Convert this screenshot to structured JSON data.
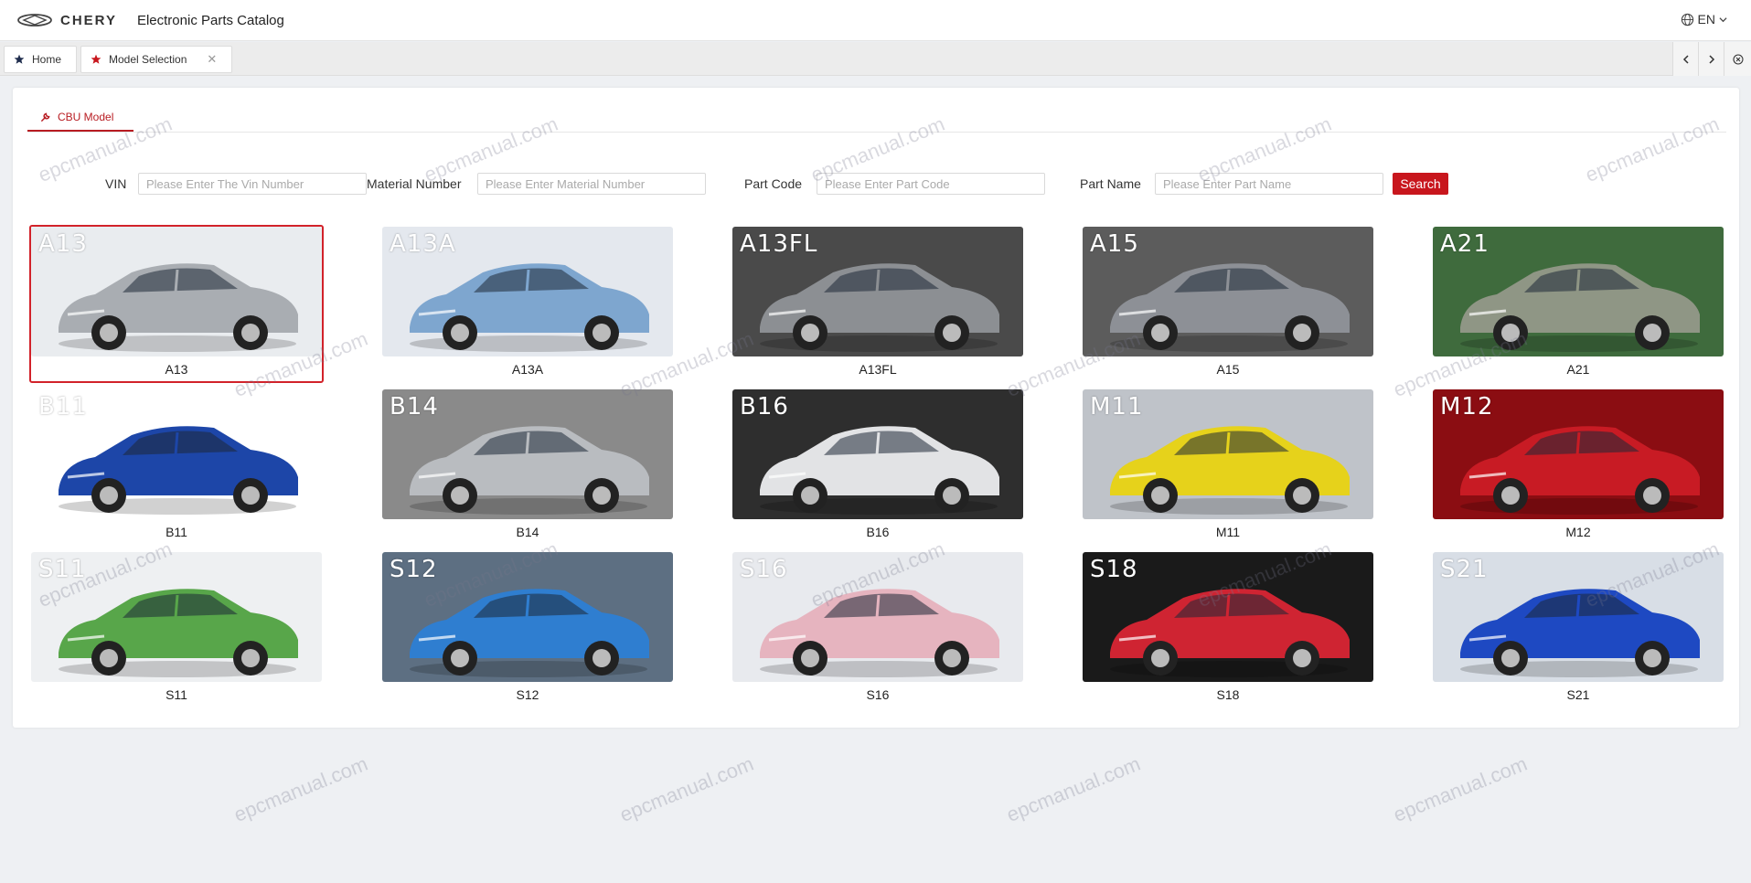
{
  "header": {
    "brand": "CHERY",
    "title": "Electronic Parts Catalog",
    "language": "EN"
  },
  "tabs": [
    {
      "label": "Home",
      "closable": false
    },
    {
      "label": "Model Selection",
      "closable": true
    }
  ],
  "section": {
    "label": "CBU Model"
  },
  "search": {
    "vin_label": "VIN",
    "vin_placeholder": "Please Enter The Vin Number",
    "material_label": "Material Number",
    "material_placeholder": "Please Enter Material Number",
    "partcode_label": "Part Code",
    "partcode_placeholder": "Please Enter Part Code",
    "partname_label": "Part Name",
    "partname_placeholder": "Please Enter Part Name",
    "button_label": "Search"
  },
  "models": [
    {
      "code": "A13",
      "label": "A13",
      "car_color": "#a9adb2",
      "bg": "#e9ecef",
      "selected": true
    },
    {
      "code": "A13A",
      "label": "A13A",
      "car_color": "#7ea6cf",
      "bg": "#e4e8ee"
    },
    {
      "code": "A13FL",
      "label": "A13FL",
      "car_color": "#8c8f93",
      "bg": "#4a4a4a"
    },
    {
      "code": "A15",
      "label": "A15",
      "car_color": "#8d9096",
      "bg": "#5c5c5c"
    },
    {
      "code": "A21",
      "label": "A21",
      "car_color": "#8f9685",
      "bg": "#3f6b3d"
    },
    {
      "code": "B11",
      "label": "B11",
      "car_color": "#1d46a8",
      "bg": "#ffffff"
    },
    {
      "code": "B14",
      "label": "B14",
      "car_color": "#b9bcc0",
      "bg": "#8a8a8a"
    },
    {
      "code": "B16",
      "label": "B16",
      "car_color": "#e2e3e5",
      "bg": "#2e2e2e"
    },
    {
      "code": "M11",
      "label": "M11",
      "car_color": "#e6d21b",
      "bg": "#bfc3c9"
    },
    {
      "code": "M12",
      "label": "M12",
      "car_color": "#c81b24",
      "bg": "#8b0d12"
    },
    {
      "code": "S11",
      "label": "S11",
      "car_color": "#58a64a",
      "bg": "#eef0f2"
    },
    {
      "code": "S12",
      "label": "S12",
      "car_color": "#2f7ed0",
      "bg": "#5d6f82"
    },
    {
      "code": "S16",
      "label": "S16",
      "car_color": "#e6b4bf",
      "bg": "#e8eaee"
    },
    {
      "code": "S18",
      "label": "S18",
      "car_color": "#cf2432",
      "bg": "#1a1a1a"
    },
    {
      "code": "S21",
      "label": "S21",
      "car_color": "#1e49c2",
      "bg": "#d8dee6"
    }
  ],
  "watermark": "epcmanual.com",
  "colors": {
    "accent": "#c8161d"
  },
  "icons": {
    "logo": "chery-logo-icon",
    "language": "globe-icon",
    "home_tab": "star-icon",
    "section": "wrench-icon"
  }
}
